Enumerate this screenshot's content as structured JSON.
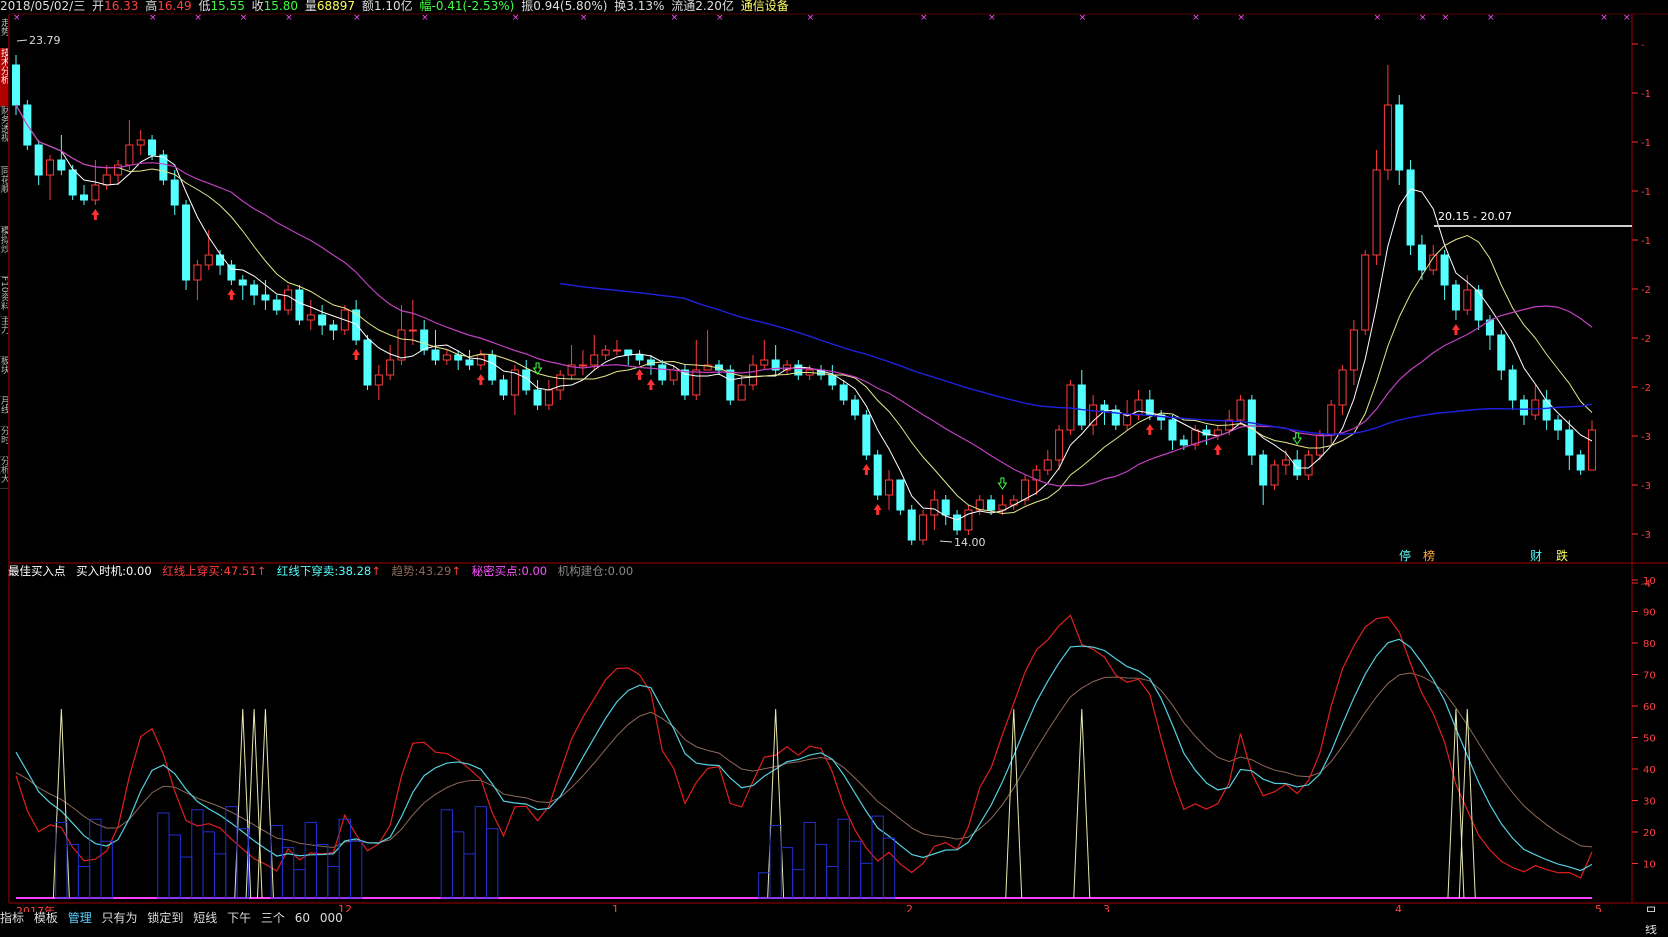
{
  "quote": {
    "date": "2018/05/02/三",
    "open_label": "开",
    "open": "16.33",
    "high_label": "高",
    "high": "16.49",
    "low_label": "低",
    "low": "15.55",
    "close_label": "收",
    "close": "15.80",
    "volume_label": "量",
    "volume": "68897",
    "amount_label": "额",
    "amount": "1.10亿",
    "change_label": "幅",
    "change": "-0.41(-2.53%)",
    "amplitude_label": "振",
    "amplitude": "0.94(5.80%)",
    "turnover_label": "换",
    "turnover": "3.13%",
    "float_label": "流通",
    "float_cap": "2.20亿",
    "sector": "通信设备"
  },
  "side_tabs": [
    "走势",
    "技术分析",
    "财务透视",
    "同花顺",
    "模拟炒",
    "F10资料",
    "主力",
    "板块",
    "月线",
    "分时",
    "分析大智慧"
  ],
  "price_chart": {
    "max_label": "23.79",
    "min_label": "14.00",
    "range_label": "20.15 - 20.07",
    "event_labels": [
      "停",
      "榜",
      "财",
      "跌"
    ],
    "right_ticks": [
      "-",
      "-1",
      "-1",
      "-1",
      "-1",
      "-2",
      "-2",
      "-2",
      "-3",
      "-3",
      "-3",
      "-4"
    ]
  },
  "indicator": {
    "name": "最佳买入点",
    "buy_time_label": "买入时机:",
    "buy_time": "0.00",
    "red_up_label": "红线上穿买:",
    "red_up": "47.51",
    "red_down_label": "红线下穿卖:",
    "red_down": "38.28",
    "trend_label": "趋势:",
    "trend": "43.29",
    "secret_label": "秘密买点:",
    "secret": "0.00",
    "inst_label": "机构建仓:",
    "inst": "0.00",
    "right_ticks": [
      "10",
      "90",
      "80",
      "70",
      "60",
      "50",
      "40",
      "30",
      "20",
      "10"
    ]
  },
  "x_axis": {
    "labels": [
      "2017年",
      "12",
      "1",
      "2",
      "3",
      "4",
      "5"
    ],
    "right_label": "日线"
  },
  "bottom_tabs": [
    "指标",
    "模板",
    "管理",
    "只有为",
    "锁定到",
    "短线",
    "下午",
    "三个",
    "60",
    "000"
  ],
  "colors": {
    "up": "#ff3c3c",
    "down": "#54ffff",
    "ma5": "#ffffff",
    "ma10": "#e6e68c",
    "ma20": "#c040c0",
    "ma60": "#2020e0",
    "grid": "#7a0000"
  },
  "chart_data": {
    "type": "candlestick",
    "price_range": [
      13.8,
      24.3
    ],
    "candles": [
      [
        23.6,
        22.8,
        23.8,
        22.6
      ],
      [
        22.8,
        22.0,
        22.9,
        21.9
      ],
      [
        22.0,
        21.4,
        22.1,
        21.2
      ],
      [
        21.4,
        21.7,
        21.8,
        20.9
      ],
      [
        21.7,
        21.5,
        22.2,
        21.4
      ],
      [
        21.5,
        21.0,
        21.6,
        20.9
      ],
      [
        21.0,
        20.9,
        21.2,
        20.8
      ],
      [
        20.9,
        21.2,
        21.7,
        20.8
      ],
      [
        21.2,
        21.4,
        21.6,
        21.1
      ],
      [
        21.4,
        21.6,
        21.7,
        21.2
      ],
      [
        21.6,
        22.0,
        22.5,
        21.5
      ],
      [
        22.0,
        22.1,
        22.3,
        21.8
      ],
      [
        22.1,
        21.8,
        22.2,
        21.7
      ],
      [
        21.8,
        21.3,
        21.9,
        21.2
      ],
      [
        21.3,
        20.8,
        21.5,
        20.6
      ],
      [
        20.8,
        19.3,
        20.9,
        19.1
      ],
      [
        19.3,
        19.6,
        19.7,
        18.9
      ],
      [
        19.6,
        19.8,
        20.3,
        19.5
      ],
      [
        19.8,
        19.6,
        19.9,
        19.4
      ],
      [
        19.6,
        19.3,
        19.7,
        19.2
      ],
      [
        19.3,
        19.2,
        19.4,
        18.9
      ],
      [
        19.2,
        19.0,
        19.3,
        18.8
      ],
      [
        19.0,
        18.9,
        19.3,
        18.7
      ],
      [
        18.9,
        18.7,
        19.0,
        18.6
      ],
      [
        18.7,
        19.1,
        19.2,
        18.6
      ],
      [
        19.1,
        18.5,
        19.2,
        18.4
      ],
      [
        18.5,
        18.6,
        18.9,
        18.3
      ],
      [
        18.6,
        18.4,
        18.8,
        18.2
      ],
      [
        18.4,
        18.3,
        18.5,
        18.1
      ],
      [
        18.3,
        18.7,
        18.8,
        18.2
      ],
      [
        18.7,
        18.1,
        18.9,
        18.0
      ],
      [
        18.1,
        17.2,
        18.2,
        17.1
      ],
      [
        17.2,
        17.4,
        17.6,
        16.9
      ],
      [
        17.4,
        17.7,
        18.0,
        17.3
      ],
      [
        17.7,
        18.3,
        18.8,
        17.6
      ],
      [
        18.3,
        18.3,
        18.9,
        18.0
      ],
      [
        18.3,
        17.9,
        18.5,
        17.8
      ],
      [
        17.9,
        17.7,
        18.3,
        17.6
      ],
      [
        17.7,
        17.8,
        17.9,
        17.6
      ],
      [
        17.8,
        17.7,
        17.9,
        17.5
      ],
      [
        17.7,
        17.6,
        17.9,
        17.5
      ],
      [
        17.6,
        17.8,
        17.9,
        17.5
      ],
      [
        17.8,
        17.3,
        17.9,
        17.2
      ],
      [
        17.3,
        17.0,
        17.4,
        16.9
      ],
      [
        17.0,
        17.5,
        17.6,
        16.6
      ],
      [
        17.5,
        17.1,
        17.7,
        17.0
      ],
      [
        17.1,
        16.8,
        17.3,
        16.7
      ],
      [
        16.8,
        17.1,
        17.3,
        16.7
      ],
      [
        17.1,
        17.4,
        17.5,
        16.9
      ],
      [
        17.4,
        17.6,
        18.0,
        17.3
      ],
      [
        17.6,
        17.6,
        17.9,
        17.4
      ],
      [
        17.6,
        17.8,
        18.2,
        17.5
      ],
      [
        17.8,
        17.9,
        18.0,
        17.7
      ],
      [
        17.9,
        17.9,
        18.1,
        17.8
      ],
      [
        17.9,
        17.8,
        17.9,
        17.6
      ],
      [
        17.8,
        17.7,
        17.9,
        17.6
      ],
      [
        17.7,
        17.6,
        17.8,
        17.4
      ],
      [
        17.6,
        17.3,
        17.7,
        17.2
      ],
      [
        17.3,
        17.5,
        17.6,
        17.2
      ],
      [
        17.5,
        17.0,
        17.6,
        16.9
      ],
      [
        17.0,
        17.5,
        18.1,
        16.9
      ],
      [
        17.5,
        17.6,
        18.3,
        17.5
      ],
      [
        17.6,
        17.5,
        17.7,
        17.4
      ],
      [
        17.5,
        16.9,
        17.6,
        16.8
      ],
      [
        16.9,
        17.2,
        17.4,
        16.9
      ],
      [
        17.2,
        17.6,
        17.8,
        17.1
      ],
      [
        17.6,
        17.7,
        18.1,
        17.5
      ],
      [
        17.7,
        17.5,
        18.0,
        17.4
      ],
      [
        17.5,
        17.6,
        17.7,
        17.4
      ],
      [
        17.6,
        17.4,
        17.7,
        17.3
      ],
      [
        17.4,
        17.5,
        17.6,
        17.3
      ],
      [
        17.5,
        17.4,
        17.6,
        17.3
      ],
      [
        17.4,
        17.2,
        17.6,
        17.1
      ],
      [
        17.2,
        16.9,
        17.3,
        16.8
      ],
      [
        16.9,
        16.6,
        17.0,
        16.5
      ],
      [
        16.6,
        15.8,
        16.7,
        15.7
      ],
      [
        15.8,
        15.0,
        15.9,
        14.9
      ],
      [
        15.0,
        15.3,
        15.5,
        14.7
      ],
      [
        15.3,
        14.7,
        15.3,
        14.6
      ],
      [
        14.7,
        14.1,
        14.8,
        14.0
      ],
      [
        14.1,
        14.6,
        14.7,
        14.0
      ],
      [
        14.6,
        14.9,
        15.1,
        14.3
      ],
      [
        14.9,
        14.6,
        15.0,
        14.4
      ],
      [
        14.6,
        14.3,
        14.7,
        14.2
      ],
      [
        14.3,
        14.7,
        14.8,
        14.2
      ],
      [
        14.7,
        14.9,
        15.0,
        14.6
      ],
      [
        14.9,
        14.7,
        15.0,
        14.6
      ],
      [
        14.7,
        14.8,
        15.0,
        14.6
      ],
      [
        14.8,
        14.9,
        15.0,
        14.7
      ],
      [
        14.9,
        15.3,
        15.4,
        14.8
      ],
      [
        15.3,
        15.5,
        15.6,
        15.0
      ],
      [
        15.5,
        15.7,
        15.9,
        15.4
      ],
      [
        15.7,
        16.3,
        16.4,
        15.5
      ],
      [
        16.3,
        17.2,
        17.3,
        16.2
      ],
      [
        17.2,
        16.4,
        17.5,
        16.3
      ],
      [
        16.4,
        16.8,
        17.0,
        16.2
      ],
      [
        16.8,
        16.7,
        16.9,
        16.4
      ],
      [
        16.7,
        16.4,
        16.8,
        16.3
      ],
      [
        16.4,
        16.6,
        16.9,
        16.3
      ],
      [
        16.6,
        16.9,
        17.1,
        16.5
      ],
      [
        16.9,
        16.6,
        17.1,
        16.5
      ],
      [
        16.6,
        16.5,
        16.7,
        16.3
      ],
      [
        16.5,
        16.1,
        16.6,
        15.9
      ],
      [
        16.1,
        16.0,
        16.2,
        15.9
      ],
      [
        16.0,
        16.3,
        16.4,
        15.9
      ],
      [
        16.3,
        16.2,
        16.4,
        16.0
      ],
      [
        16.2,
        16.3,
        16.4,
        16.1
      ],
      [
        16.3,
        16.5,
        16.7,
        16.2
      ],
      [
        16.5,
        16.9,
        17.0,
        16.4
      ],
      [
        16.9,
        15.8,
        17.0,
        15.6
      ],
      [
        15.8,
        15.2,
        15.9,
        14.8
      ],
      [
        15.2,
        15.6,
        15.7,
        15.1
      ],
      [
        15.6,
        15.7,
        15.9,
        15.4
      ],
      [
        15.7,
        15.4,
        15.9,
        15.3
      ],
      [
        15.4,
        15.8,
        15.9,
        15.3
      ],
      [
        15.8,
        16.2,
        16.3,
        15.7
      ],
      [
        16.2,
        16.8,
        16.9,
        16.0
      ],
      [
        16.8,
        17.5,
        17.6,
        16.6
      ],
      [
        17.5,
        18.3,
        18.5,
        17.2
      ],
      [
        18.3,
        19.8,
        19.9,
        18.2
      ],
      [
        19.8,
        21.5,
        21.9,
        19.6
      ],
      [
        21.5,
        22.8,
        23.6,
        21.3
      ],
      [
        22.8,
        21.5,
        23.0,
        21.2
      ],
      [
        21.5,
        20.0,
        21.7,
        19.8
      ],
      [
        20.0,
        19.5,
        20.2,
        19.3
      ],
      [
        19.5,
        19.8,
        20.0,
        19.4
      ],
      [
        19.8,
        19.2,
        19.9,
        18.9
      ],
      [
        19.2,
        18.7,
        19.3,
        18.5
      ],
      [
        18.7,
        19.1,
        19.4,
        18.6
      ],
      [
        19.1,
        18.5,
        19.2,
        18.3
      ],
      [
        18.5,
        18.2,
        18.6,
        17.9
      ],
      [
        18.2,
        17.5,
        18.3,
        17.3
      ],
      [
        17.5,
        16.9,
        17.6,
        16.7
      ],
      [
        16.9,
        16.6,
        17.0,
        16.4
      ],
      [
        16.6,
        16.9,
        17.2,
        16.5
      ],
      [
        16.9,
        16.5,
        17.1,
        16.3
      ],
      [
        16.5,
        16.3,
        16.6,
        16.1
      ],
      [
        16.3,
        15.8,
        16.5,
        15.5
      ],
      [
        15.8,
        15.5,
        15.9,
        15.4
      ],
      [
        15.5,
        16.3,
        16.49,
        15.55
      ]
    ],
    "ma5_visible": true,
    "ma10_visible": true,
    "ma20_visible": true,
    "ma60_visible": true,
    "indicator_range": [
      0,
      100
    ]
  }
}
